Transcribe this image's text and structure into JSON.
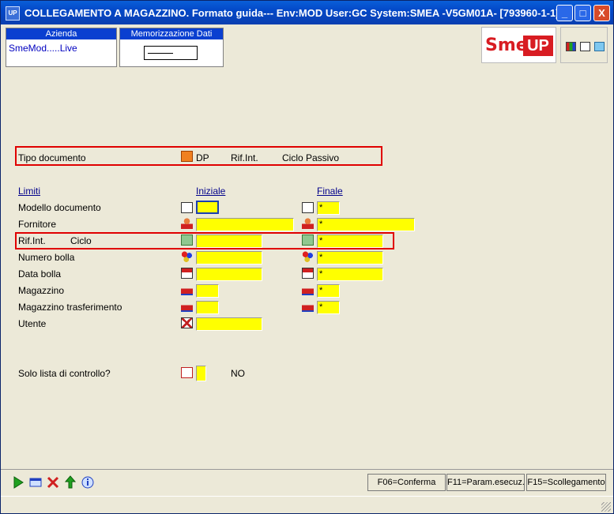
{
  "window": {
    "title": "COLLEGAMENTO A MAGAZZINO.  Formato guida--- Env:MOD User:GC System:SMEA -V5GM01A- [793960-1-1]",
    "app_icon": "UP",
    "controls": [
      "_",
      "□",
      "X"
    ]
  },
  "header": {
    "azienda_label": "Azienda",
    "azienda_value": "SmeMod.....Live",
    "memorizzazione_label": "Memorizzazione Dati Video",
    "logo_sme": "Sme.",
    "logo_up": "UP"
  },
  "form": {
    "tipo_documento": {
      "label": "Tipo documento",
      "code": "DP",
      "rif": "Rif.Int.",
      "desc": "Ciclo Passivo"
    },
    "limiti_label": "Limiti",
    "iniziale_label": "Iniziale",
    "finale_label": "Finale",
    "rows": [
      {
        "label": "Modello documento",
        "icon": "grid-icon",
        "ini": "",
        "fin": "*"
      },
      {
        "label": "Fornitore",
        "icon": "person-icon",
        "ini": "",
        "fin": "*"
      },
      {
        "label": "Rif.Int.",
        "label2": "Ciclo",
        "icon": "document-tag-icon",
        "ini": "",
        "fin": "*"
      },
      {
        "label": "Numero bolla",
        "icon": "balls-icon",
        "ini": "",
        "fin": "*"
      },
      {
        "label": "Data bolla",
        "icon": "calendar-icon",
        "ini": "",
        "fin": "*"
      },
      {
        "label": "Magazzino",
        "icon": "factory-icon",
        "ini": "",
        "fin": "*"
      },
      {
        "label": "Magazzino trasferimento",
        "icon": "factory-icon",
        "ini": "",
        "fin": "*"
      },
      {
        "label": "Utente",
        "icon": "user-cross-icon",
        "ini": ""
      }
    ],
    "solo_lista": {
      "label": "Solo lista di controllo?",
      "icon": "yes-no-icon",
      "value": "NO"
    }
  },
  "bottombar": {
    "buttons": [
      "run-icon",
      "window-icon",
      "cancel-icon",
      "back-icon",
      "info-icon"
    ],
    "fkeys": [
      "F06=Conferma",
      "F11=Param.esecuz.",
      "F15=Scollegamento"
    ]
  }
}
